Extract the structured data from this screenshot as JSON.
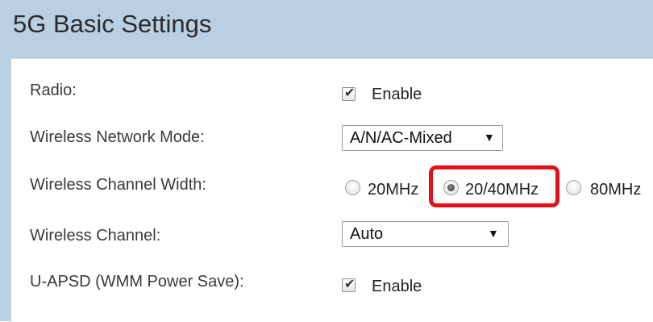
{
  "section": {
    "title": "5G Basic Settings"
  },
  "colors": {
    "highlight": "#e0111a",
    "frame": "#b9cfe2"
  },
  "rows": {
    "radio": {
      "label": "Radio:",
      "checkbox_label": "Enable",
      "checked": true
    },
    "network_mode": {
      "label": "Wireless Network Mode:",
      "selected": "A/N/AC-Mixed"
    },
    "channel_width": {
      "label": "Wireless Channel Width:",
      "options": [
        "20MHz",
        "20/40MHz",
        "80MHz"
      ],
      "selected": "20/40MHz"
    },
    "channel": {
      "label": "Wireless Channel:",
      "selected": "Auto"
    },
    "uapsd": {
      "label": "U-APSD (WMM Power Save):",
      "checkbox_label": "Enable",
      "checked": true
    }
  },
  "icons": {
    "dropdown": "triangle-down",
    "check": "check-mark"
  }
}
